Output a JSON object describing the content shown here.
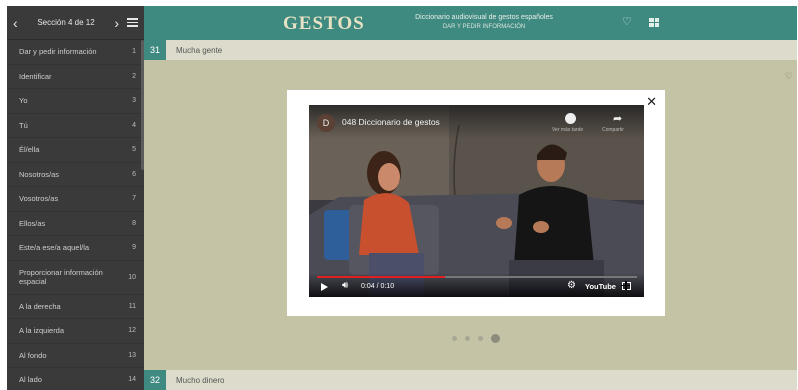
{
  "sidebar": {
    "section_label": "Sección 4 de 12",
    "prev_icon": "chevron-left-icon",
    "next_icon": "chevron-right-icon",
    "menu_icon": "hamburger-icon",
    "items": [
      {
        "label": "Dar y pedir información",
        "num": "1"
      },
      {
        "label": "Identificar",
        "num": "2"
      },
      {
        "label": "Yo",
        "num": "3"
      },
      {
        "label": "Tú",
        "num": "4"
      },
      {
        "label": "Él/ella",
        "num": "5"
      },
      {
        "label": "Nosotros/as",
        "num": "6"
      },
      {
        "label": "Vosotros/as",
        "num": "7"
      },
      {
        "label": "Ellos/as",
        "num": "8"
      },
      {
        "label": "Este/a ese/a aquel/la",
        "num": "9"
      },
      {
        "label": "Proporcionar información espacial",
        "num": "10"
      },
      {
        "label": "A la derecha",
        "num": "11"
      },
      {
        "label": "A la izquierda",
        "num": "12"
      },
      {
        "label": "Al fondo",
        "num": "13"
      },
      {
        "label": "Al lado",
        "num": "14"
      }
    ]
  },
  "header": {
    "logo": "GESTOS",
    "subtitle": "Diccionario audiovisual de gestos españoles",
    "section": "DAR Y PEDIR INFORMACIÓN"
  },
  "content": {
    "row_top": {
      "num": "31",
      "title": "Mucha gente"
    },
    "row_bottom": {
      "num": "32",
      "title": "Mucho dinero"
    },
    "pager_active": 4,
    "pager_total": 4
  },
  "video": {
    "channel_initial": "D",
    "title": "048 Diccionario de gestos",
    "time": "0:04 / 0:10",
    "progress": 0.4,
    "brand": "YouTube",
    "watch_later_label": "Ver más tarde",
    "share_label": "Compartir"
  },
  "colors": {
    "accent": "#3e8a80",
    "sidebar": "#3a3a3a",
    "content_bg": "#c5c3a6"
  }
}
